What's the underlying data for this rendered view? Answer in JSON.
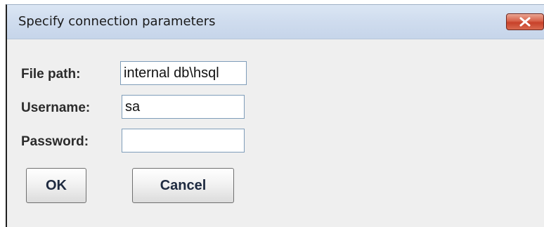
{
  "window": {
    "title": "Specify connection parameters"
  },
  "form": {
    "file_path": {
      "label": "File path:",
      "value": "internal db\\hsql"
    },
    "username": {
      "label": "Username:",
      "value": "sa"
    },
    "password": {
      "label": "Password:",
      "value": ""
    }
  },
  "buttons": {
    "ok_label": "OK",
    "cancel_label": "Cancel"
  },
  "icons": {
    "close": "close-icon"
  },
  "colors": {
    "close_button": "#d8624a",
    "titlebar": "#cfdcee",
    "dialog_background": "#efefef"
  }
}
